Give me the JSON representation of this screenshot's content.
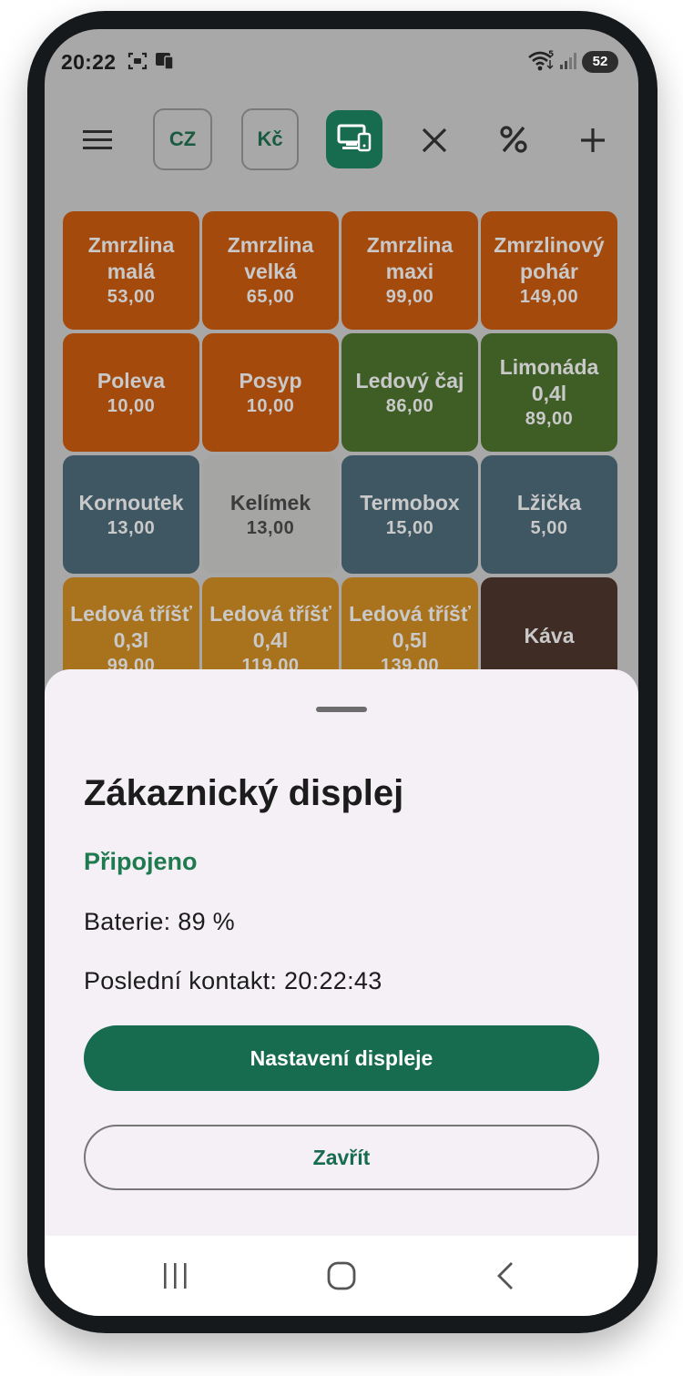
{
  "status_bar": {
    "time": "20:22",
    "icons": [
      "screenshot-icon",
      "cast-icon",
      "wifi-icon",
      "signal-icon"
    ],
    "wifi_badge": "5",
    "battery": "52"
  },
  "toolbar": {
    "language_label": "CZ",
    "currency_label": "Kč",
    "icons": [
      "menu-icon",
      "customer-display-icon",
      "close-icon",
      "percent-icon",
      "plus-icon"
    ]
  },
  "products": [
    {
      "name": "Zmrzlina\nmalá",
      "price": "53,00",
      "color": "#a54a0d"
    },
    {
      "name": "Zmrzlina\nvelká",
      "price": "65,00",
      "color": "#a54a0d"
    },
    {
      "name": "Zmrzlina\nmaxi",
      "price": "99,00",
      "color": "#a54a0d"
    },
    {
      "name": "Zmrzlinový\npohár",
      "price": "149,00",
      "color": "#a54a0d"
    },
    {
      "name": "Poleva",
      "price": "10,00",
      "color": "#a54a0d"
    },
    {
      "name": "Posyp",
      "price": "10,00",
      "color": "#a54a0d"
    },
    {
      "name": "Ledový čaj",
      "price": "86,00",
      "color": "#3f5e26"
    },
    {
      "name": "Limonáda\n0,4l",
      "price": "89,00",
      "color": "#3f5e26"
    },
    {
      "name": "Kornoutek",
      "price": "13,00",
      "color": "#3f5762"
    },
    {
      "name": "Kelímek",
      "price": "13,00",
      "color": "#a5a6a4"
    },
    {
      "name": "Termobox",
      "price": "15,00",
      "color": "#3f5762"
    },
    {
      "name": "Lžička",
      "price": "5,00",
      "color": "#3f5762"
    },
    {
      "name": "Ledová tříšť\n0,3l",
      "price": "99,00",
      "color": "#a9721d"
    },
    {
      "name": "Ledová tříšť\n0,4l",
      "price": "119,00",
      "color": "#a9721d"
    },
    {
      "name": "Ledová tříšť\n0,5l",
      "price": "139,00",
      "color": "#a9721d"
    },
    {
      "name": "Káva",
      "price": "",
      "color": "#3f2c25"
    }
  ],
  "sheet": {
    "title": "Zákaznický displej",
    "status": "Připojeno",
    "battery": "Baterie: 89 %",
    "last_contact": "Poslední kontakt: 20:22:43",
    "primary_button": "Nastavení displeje",
    "secondary_button": "Zavřít"
  },
  "colors": {
    "accent": "#176b4e",
    "connected": "#1f7a4f",
    "sheet_bg": "#f4f0f6"
  }
}
